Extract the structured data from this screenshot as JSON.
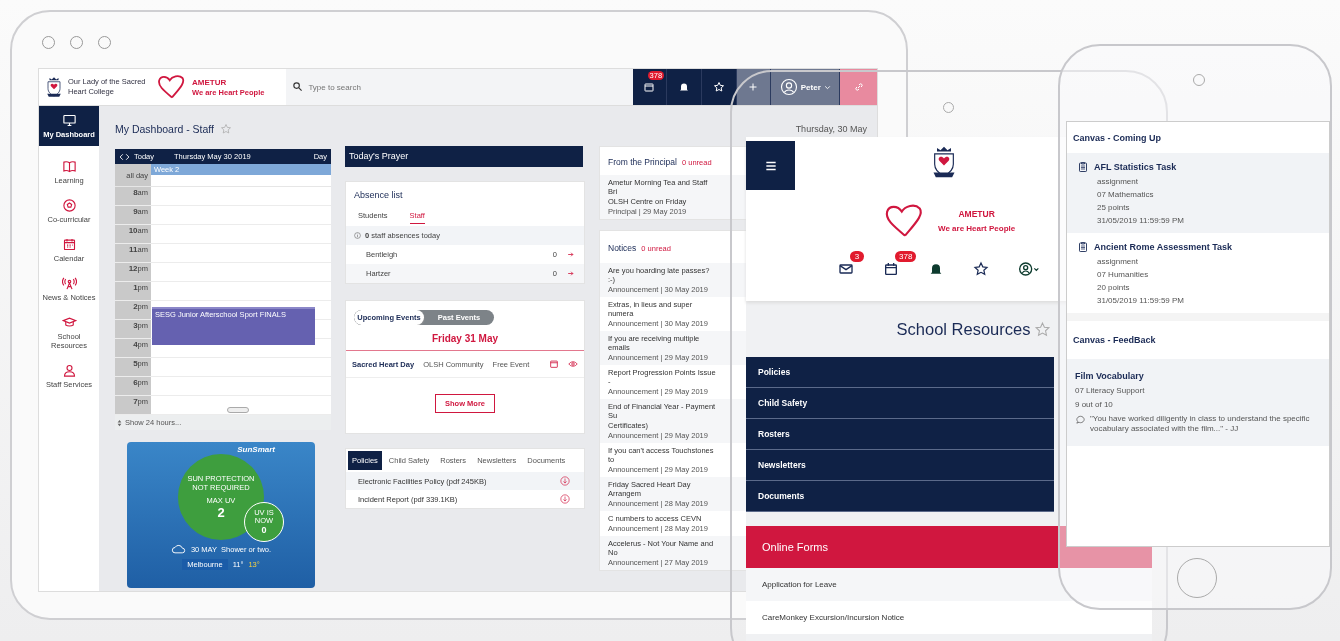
{
  "tablet": {
    "header": {
      "school_name": "Our Lady of the Sacred Heart College",
      "brand_title": "AMETUR",
      "brand_tagline": "We are Heart People",
      "search": {
        "placeholder": "Type to search"
      },
      "calendar_badge": "378",
      "user": "Peter"
    },
    "nav": [
      {
        "label": "My Dashboard",
        "selected": true
      },
      {
        "label": "Learning",
        "selected": false
      },
      {
        "label": "Co-curricular",
        "selected": false
      },
      {
        "label": "Calendar",
        "selected": false
      },
      {
        "label": "News & Notices",
        "selected": false
      },
      {
        "label": "School Resources",
        "selected": false
      },
      {
        "label": "Staff Services",
        "selected": false
      }
    ],
    "page_title": "My Dashboard - Staff",
    "date": "Thursday, 30 May",
    "calendar": {
      "today": "Today",
      "date": "Thursday May 30 2019",
      "view": "Day",
      "all_day_label": "all day",
      "all_day_event": "Week 2",
      "hours": [
        {
          "num": "8",
          "ampm": "am"
        },
        {
          "num": "9",
          "ampm": "am"
        },
        {
          "num": "10",
          "ampm": "am"
        },
        {
          "num": "11",
          "ampm": "am"
        },
        {
          "num": "12",
          "ampm": "pm"
        },
        {
          "num": "1",
          "ampm": "pm"
        },
        {
          "num": "2",
          "ampm": "pm"
        },
        {
          "num": "3",
          "ampm": "pm"
        },
        {
          "num": "4",
          "ampm": "pm"
        },
        {
          "num": "5",
          "ampm": "pm"
        },
        {
          "num": "6",
          "ampm": "pm"
        },
        {
          "num": "7",
          "ampm": "pm"
        }
      ],
      "event": "SESG Junior Afterschool Sport FINALS",
      "show_hours": "Show 24 hours..."
    },
    "sunsmart": {
      "logo": "SunSmart",
      "status": "SUN PROTECTION NOT REQUIRED",
      "max_uv_label": "MAX UV",
      "max_uv": "2",
      "uv_now_label": "UV IS NOW",
      "uv_now": "0",
      "forecast_date": "30 MAY",
      "forecast": "Shower or two.",
      "location": "Melbourne",
      "temp_min": "11°",
      "temp_max": "13°"
    },
    "prayer": {
      "title": "Today's Prayer"
    },
    "absence": {
      "title": "Absence list",
      "tabs": [
        {
          "label": "Students",
          "selected": false
        },
        {
          "label": "Staff",
          "selected": true
        }
      ],
      "summary": "**0** staff absences today",
      "rows": [
        {
          "campus": "Bentleigh",
          "count": "0"
        },
        {
          "campus": "Hartzer",
          "count": "0"
        }
      ]
    },
    "events": {
      "toggle": [
        {
          "label": "Upcoming Events",
          "selected": true
        },
        {
          "label": "Past Events",
          "selected": false
        }
      ],
      "date": "Friday 31 May",
      "items": [
        {
          "name": "Sacred Heart Day",
          "audience": "OLSH Community",
          "cost": "Free Event"
        }
      ],
      "show_more": "Show More"
    },
    "resources": {
      "tabs": [
        {
          "label": "Policies",
          "selected": true
        },
        {
          "label": "Child Safety",
          "selected": false
        },
        {
          "label": "Rosters",
          "selected": false
        },
        {
          "label": "Newsletters",
          "selected": false
        },
        {
          "label": "Documents",
          "selected": false
        }
      ],
      "files": [
        "Electronic Facilities Policy (pdf 245KB)",
        "Incident Report (pdf 339.1KB)"
      ]
    },
    "principal": {
      "title": "From the Principal",
      "unread": "0 unread",
      "items": [
        {
          "lines": [
            "Ametur Morning Tea and Staff Bri",
            "OLSH Centre on Friday"
          ],
          "meta": "Principal | 29 May 2019"
        }
      ]
    },
    "notices": {
      "title": "Notices",
      "unread": "0 unread",
      "items": [
        {
          "lines": [
            "Are you hoarding late passes? :-)"
          ],
          "meta": "Announcement | 30 May 2019"
        },
        {
          "lines": [
            "Extras, in lieus and super numera"
          ],
          "meta": "Announcement | 30 May 2019"
        },
        {
          "lines": [
            "If you are receiving multiple emails"
          ],
          "meta": "Announcement | 29 May 2019"
        },
        {
          "lines": [
            "Report Progression Points Issue -"
          ],
          "meta": "Announcement | 29 May 2019"
        },
        {
          "lines": [
            "End of Financial Year - Payment Su",
            "Certificates)"
          ],
          "meta": "Announcement | 29 May 2019"
        },
        {
          "lines": [
            "If you can't access Touchstones to"
          ],
          "meta": "Announcement | 29 May 2019"
        },
        {
          "lines": [
            "Friday Sacred Heart Day Arrangem"
          ],
          "meta": "Announcement | 28 May 2019"
        },
        {
          "lines": [
            "C numbers to access CEVN"
          ],
          "meta": "Announcement | 28 May 2019"
        },
        {
          "lines": [
            "Accelerus - Not Your Name and No"
          ],
          "meta": "Announcement | 27 May 2019"
        }
      ]
    }
  },
  "phone": {
    "brand_title": "AMETUR",
    "brand_tagline": "We are Heart People",
    "mail_badge": "3",
    "calendar_badge": "378",
    "title": "School Resources",
    "links": [
      "Policies",
      "Child Safety",
      "Rosters",
      "Newsletters",
      "Documents"
    ],
    "forms_title": "Online Forms",
    "forms": [
      "Application for Leave",
      "CareMonkey Excursion/Incursion Notice"
    ]
  },
  "phone_small": {
    "coming_up": {
      "title": "Canvas - Coming Up",
      "items": [
        {
          "name": "AFL Statistics Task",
          "type": "assignment",
          "subject": "07 Mathematics",
          "points": "25 points",
          "due": "31/05/2019 11:59:59 PM"
        },
        {
          "name": "Ancient Rome Assessment Task",
          "type": "assignment",
          "subject": "07 Humanities",
          "points": "20 points",
          "due": "31/05/2019 11:59:59 PM"
        }
      ]
    },
    "feedback": {
      "title": "Canvas - FeedBack",
      "items": [
        {
          "name": "Film Vocabulary",
          "subject": "07 Literacy Support",
          "score": "9 out of 10",
          "comment": "\"You have worked diligently in class to understand the specific vocabulary associated with the film...\" - JJ"
        }
      ]
    }
  }
}
